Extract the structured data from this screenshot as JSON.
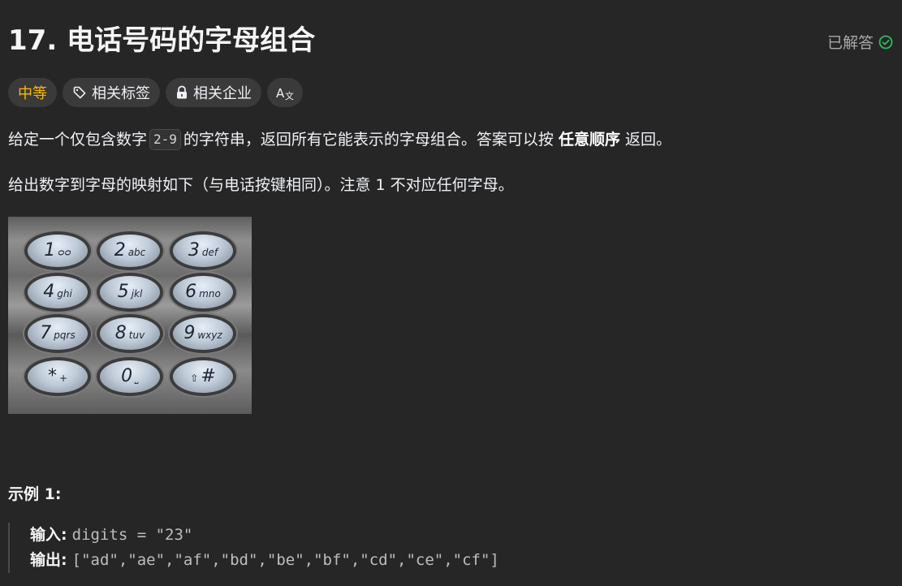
{
  "problem": {
    "title": "17. 电话号码的字母组合",
    "status": "已解答"
  },
  "tags": {
    "difficulty": "中等",
    "related_tags": "相关标签",
    "related_companies": "相关企业",
    "translate": "A文"
  },
  "description": {
    "p1_before": "给定一个仅包含数字",
    "p1_code": "2-9",
    "p1_middle": "的字符串，返回所有它能表示的字母组合。答案可以按",
    "p1_bold": "任意顺序",
    "p1_after": "返回。",
    "p2": "给出数字到字母的映射如下（与电话按键相同）。注意 1 不对应任何字母。"
  },
  "keypad": {
    "keys": [
      {
        "num": "1",
        "letters": "ᴑᴑ"
      },
      {
        "num": "2",
        "letters": "abc"
      },
      {
        "num": "3",
        "letters": "def"
      },
      {
        "num": "4",
        "letters": "ghi"
      },
      {
        "num": "5",
        "letters": "jkl"
      },
      {
        "num": "6",
        "letters": "mno"
      },
      {
        "num": "7",
        "letters": "pqrs"
      },
      {
        "num": "8",
        "letters": "tuv"
      },
      {
        "num": "9",
        "letters": "wxyz"
      },
      {
        "num": "*",
        "letters": "+"
      },
      {
        "num": "0",
        "letters": "⎵"
      },
      {
        "num": "#",
        "letters": "⇧"
      }
    ]
  },
  "example": {
    "title": "示例 1:",
    "input_label": "输入:",
    "input_value": "digits = \"23\"",
    "output_label": "输出:",
    "output_value": "[\"ad\",\"ae\",\"af\",\"bd\",\"be\",\"bf\",\"cd\",\"ce\",\"cf\"]"
  },
  "colors": {
    "background": "#262626",
    "difficulty_medium": "#ffb800",
    "solved_check": "#2cbb5d"
  }
}
